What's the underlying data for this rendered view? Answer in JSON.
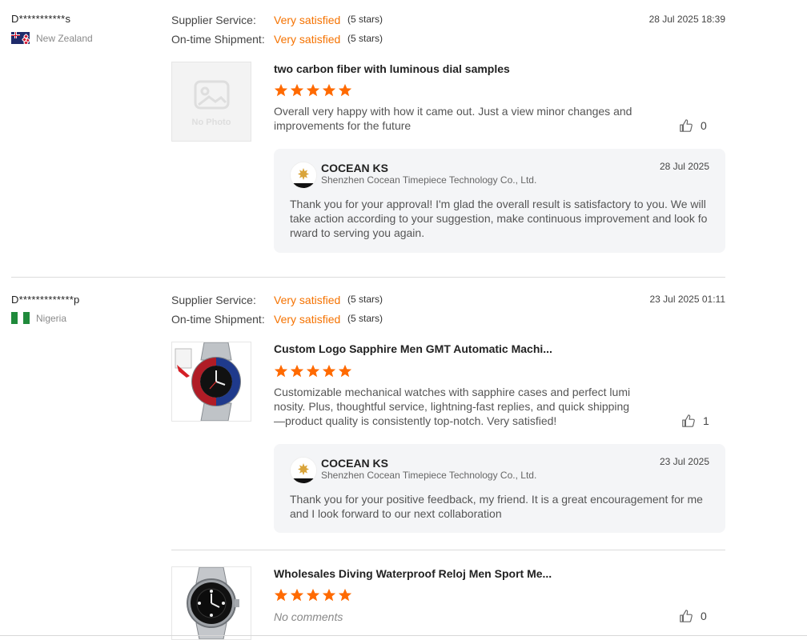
{
  "labels": {
    "supplier_service": "Supplier Service:",
    "ontime_shipment": "On-time Shipment:"
  },
  "colors": {
    "accent": "#f57200",
    "star": "#ff6a00",
    "reply_bg": "#f4f5f7"
  },
  "reviews": [
    {
      "reviewer": "D***********s",
      "country": "New Zealand",
      "flag": "new-zealand-flag",
      "supplier_service": "Very satisfied",
      "supplier_service_stars": "(5 stars)",
      "ontime_shipment": "Very satisfied",
      "ontime_shipment_stars": "(5 stars)",
      "date": "28 Jul 2025 18:39",
      "items": [
        {
          "thumb_icon": "no-photo-placeholder-icon",
          "thumb_text": "No Photo",
          "title": "two carbon fiber with luminous dial samples",
          "rating": 5,
          "comment": "Overall very happy with how it came out. Just a view minor changes and improvements for the future",
          "likes": "0",
          "reply": {
            "name": "COCEAN KS",
            "company": "Shenzhen Cocean Timepiece Technology Co., Ltd.",
            "date": "28 Jul 2025",
            "text": "Thank you for your approval! I'm glad the overall result is satisfactory to you. We will take action according to your suggestion, make continuous improvement and look forward to serving you again."
          }
        }
      ]
    },
    {
      "reviewer": "D*************p",
      "country": "Nigeria",
      "flag": "nigeria-flag",
      "supplier_service": "Very satisfied",
      "supplier_service_stars": "(5 stars)",
      "ontime_shipment": "Very satisfied",
      "ontime_shipment_stars": "(5 stars)",
      "date": "23 Jul 2025 01:11",
      "items": [
        {
          "thumb_icon": "gmt-watch-product-image",
          "title": "Custom Logo Sapphire Men GMT Automatic Machi...",
          "rating": 5,
          "comment": "Customizable mechanical watches with sapphire cases and perfect luminosity. Plus, thoughtful service, lightning-fast replies, and quick shipping—product quality is consistently top-notch. Very satisfied!",
          "likes": "1",
          "reply": {
            "name": "COCEAN KS",
            "company": "Shenzhen Cocean Timepiece Technology Co., Ltd.",
            "date": "23 Jul 2025",
            "text": "Thank you for your positive feedback, my friend. It is a great encouragement for me and I look forward to our next collaboration"
          }
        },
        {
          "thumb_icon": "diving-watch-product-image",
          "title": "Wholesales Diving Waterproof Reloj Men Sport Me...",
          "rating": 5,
          "comment": "No comments",
          "likes": "0"
        }
      ]
    }
  ]
}
